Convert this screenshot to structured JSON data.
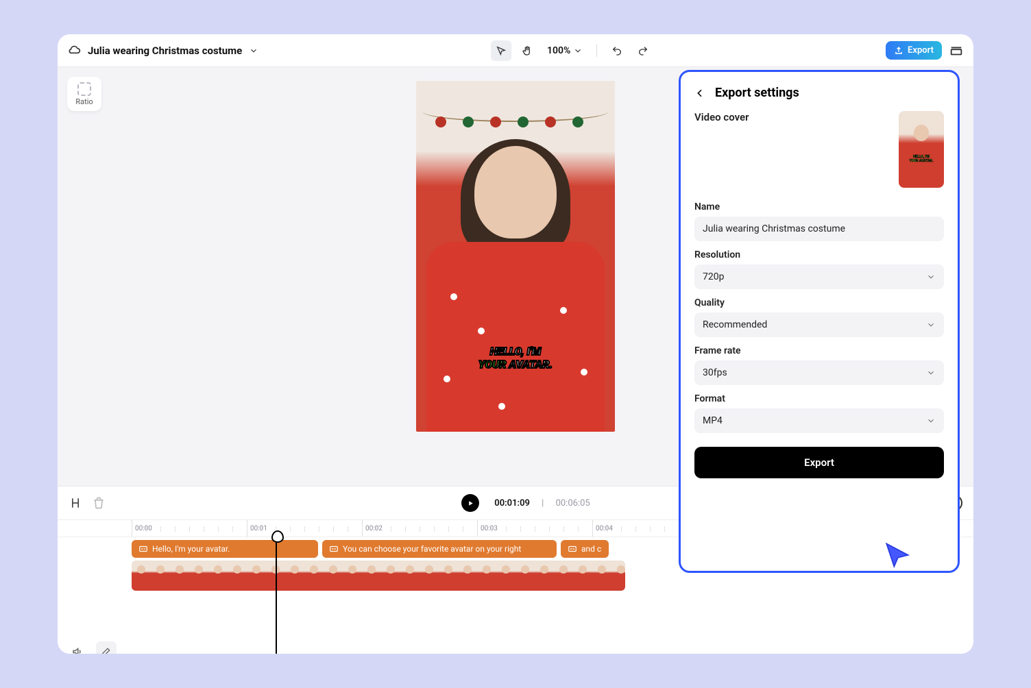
{
  "project": {
    "title": "Julia wearing Christmas costume"
  },
  "toolbar": {
    "zoom": "100%",
    "export_label": "Export",
    "ratio_label": "Ratio"
  },
  "preview_caption": {
    "line1": "HELLO, I'M",
    "line2_your": "YOUR",
    "line2_avatar": " AVATAR."
  },
  "timeline": {
    "current": "00:01:09",
    "duration": "00:06:05",
    "ticks": [
      "00:00",
      "00:01",
      "00:02",
      "00:03",
      "00:04"
    ],
    "caption_clips": [
      "Hello, I'm your avatar.",
      "You can choose your favorite avatar on your right",
      "and c"
    ]
  },
  "export_panel": {
    "title": "Export settings",
    "video_cover_label": "Video cover",
    "name_label": "Name",
    "name_value": "Julia wearing Christmas costume",
    "resolution_label": "Resolution",
    "resolution_value": "720p",
    "quality_label": "Quality",
    "quality_value": "Recommended",
    "framerate_label": "Frame rate",
    "framerate_value": "30fps",
    "format_label": "Format",
    "format_value": "MP4",
    "export_button": "Export"
  }
}
